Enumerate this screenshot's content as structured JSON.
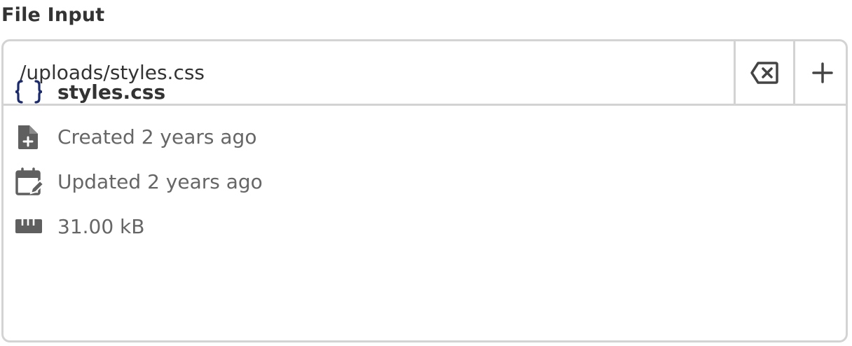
{
  "field": {
    "label": "File Input"
  },
  "input": {
    "value": "/uploads/styles.css"
  },
  "actions": {
    "clear_icon": "backspace-clear-icon",
    "add_icon": "plus-icon"
  },
  "file": {
    "name": "styles.css",
    "type_icon": "curly-braces-icon",
    "created": "Created 2 years ago",
    "created_icon": "file-plus-icon",
    "updated": "Updated 2 years ago",
    "updated_icon": "calendar-edit-icon",
    "size": "31.00 kB",
    "size_icon": "ruler-icon"
  },
  "colors": {
    "border": "#d3d3d3",
    "text_primary": "#333333",
    "text_secondary": "#666666",
    "icon_gray": "#5f5f5f",
    "css_icon": "#1a2a6c"
  }
}
